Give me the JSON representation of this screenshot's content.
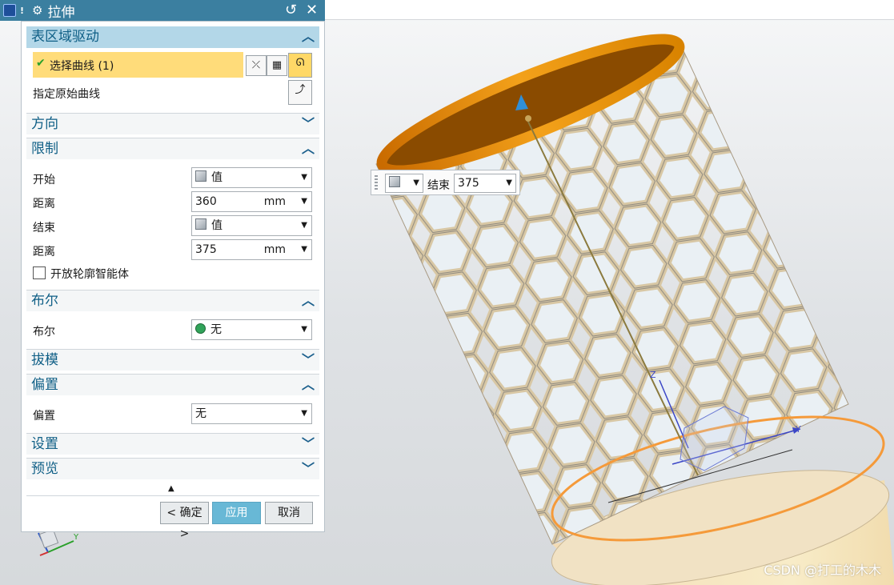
{
  "window": {
    "title": "拉伸"
  },
  "section_region": {
    "title": "表区域驱动",
    "select_curve": "选择曲线 (1)",
    "original_curve": "指定原始曲线"
  },
  "section_direction": {
    "title": "方向"
  },
  "section_limits": {
    "title": "限制",
    "start_label": "开始",
    "start_value": "值",
    "distance1_label": "距离",
    "distance1_value": "360",
    "distance1_unit": "mm",
    "end_label": "结束",
    "end_value": "值",
    "distance2_label": "距离",
    "distance2_value": "375",
    "distance2_unit": "mm",
    "open_profile": "开放轮廓智能体"
  },
  "section_boolean": {
    "title": "布尔",
    "label": "布尔",
    "value": "无"
  },
  "section_draft": {
    "title": "拔模"
  },
  "section_offset": {
    "title": "偏置",
    "label": "偏置",
    "value": "无"
  },
  "section_settings": {
    "title": "设置"
  },
  "section_preview": {
    "title": "预览"
  },
  "buttons": {
    "ok": "< 确定 >",
    "apply": "应用",
    "cancel": "取消"
  },
  "float_toolbar": {
    "label": "结束",
    "value": "375"
  },
  "axes": {
    "x": "X",
    "y": "Y",
    "z": "Z"
  },
  "watermark": "CSDN @打工的木木",
  "colors": {
    "title_bar": "#3b7fa0",
    "accent": "#0f5f86",
    "highlight": "#ffdc7a",
    "primary_button": "#68b8d6"
  }
}
